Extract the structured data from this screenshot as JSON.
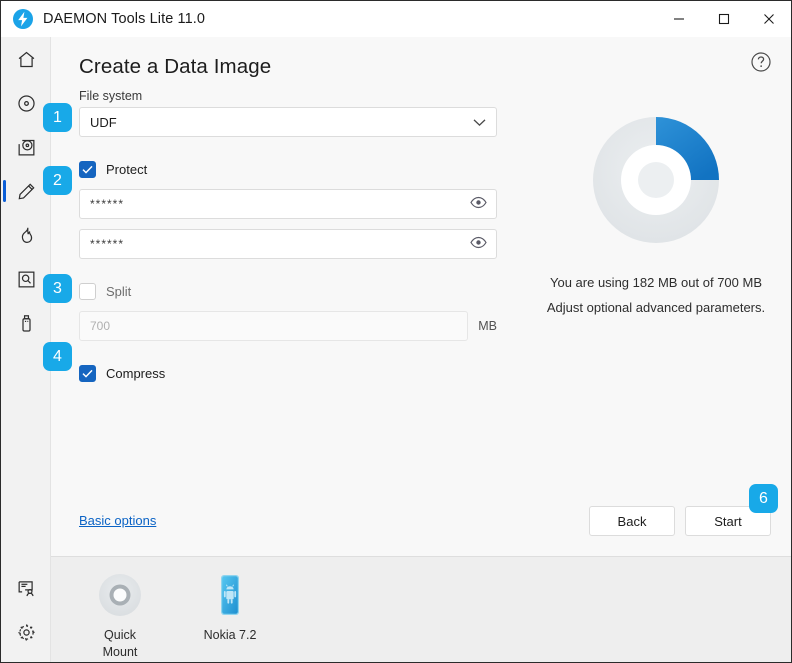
{
  "window": {
    "title": "DAEMON Tools Lite 11.0",
    "logo_icon": "daemon-tools-logo",
    "controls": {
      "minimize": "minimize-icon",
      "maximize": "maximize-icon",
      "close": "close-icon"
    }
  },
  "sidebar": {
    "top_items": [
      {
        "icon": "home-icon",
        "name": "home"
      },
      {
        "icon": "disc-icon",
        "name": "disc-image"
      },
      {
        "icon": "disc-in-drive-icon",
        "name": "virtual-drive"
      },
      {
        "icon": "pencil-icon",
        "name": "create-image",
        "active": true
      },
      {
        "icon": "flame-icon",
        "name": "burn"
      },
      {
        "icon": "image-search-icon",
        "name": "image-catalog"
      },
      {
        "icon": "usb-icon",
        "name": "usb-boot"
      }
    ],
    "bottom_items": [
      {
        "icon": "feedback-account-icon",
        "name": "feedback"
      },
      {
        "icon": "gear-icon",
        "name": "settings"
      }
    ]
  },
  "main": {
    "title": "Create a Data Image",
    "help_icon": "help-circle-icon",
    "file_system": {
      "label": "File system",
      "value": "UDF",
      "chevron_icon": "chevron-down-icon",
      "badge": "1"
    },
    "protect": {
      "label": "Protect",
      "checked": true,
      "badge": "2",
      "password": "******",
      "password_confirm": "******",
      "reveal_icon": "eye-icon"
    },
    "split": {
      "label": "Split",
      "checked": false,
      "badge": "3",
      "placeholder": "700",
      "value": "",
      "unit": "MB"
    },
    "compress": {
      "label": "Compress",
      "checked": true,
      "badge": "4"
    },
    "basic_options_link": "Basic options",
    "buttons": {
      "back": "Back",
      "start": "Start",
      "start_badge": "6"
    }
  },
  "usage": {
    "line1": "You are using 182 MB out of 700 MB",
    "line2": "Adjust optional advanced parameters.",
    "used_mb": 182,
    "total_mb": 700,
    "used_fraction": 0.26,
    "donut_colors": {
      "used": "#1878c8",
      "free": "#e2e5e7"
    }
  },
  "dock": {
    "items": [
      {
        "label": "Quick\nMount",
        "label_line1": "Quick",
        "label_line2": "Mount",
        "icon": "disc-donut-icon"
      },
      {
        "label": "Nokia 7.2",
        "label_line1": "Nokia 7.2",
        "label_line2": "",
        "icon": "android-phone-icon"
      }
    ]
  },
  "colors": {
    "accent_blue": "#1878c8",
    "badge_blue": "#18a9e8",
    "checkbox_blue": "#1565c0",
    "link_blue": "#0b63c5"
  }
}
